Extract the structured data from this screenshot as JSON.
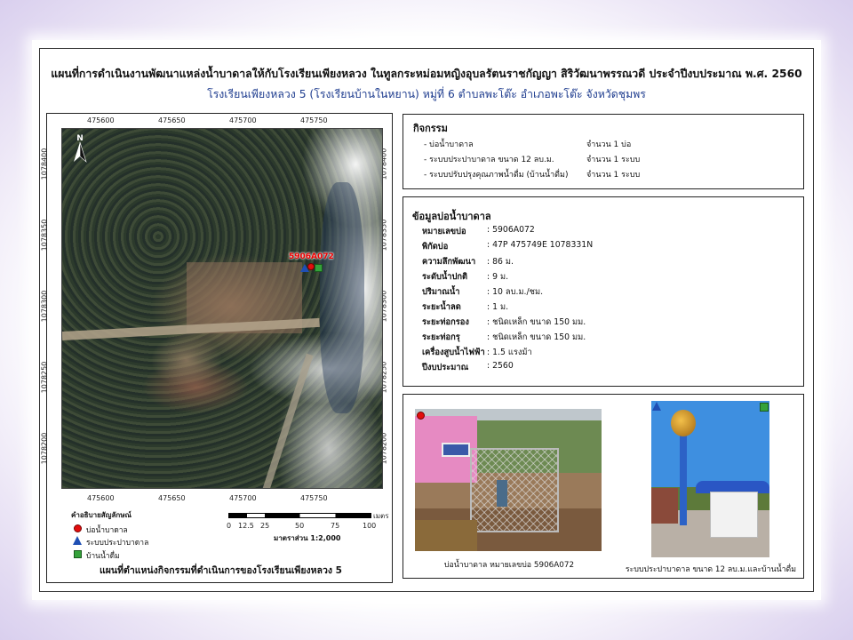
{
  "title": {
    "line1": "แผนที่การดำเนินงานพัฒนาแหล่งน้ำบาดาลให้กับโรงเรียนเพียงหลวง ในทูลกระหม่อมหญิงอุบลรัตนราชกัญญา สิริวัฒนาพรรณวดี ประจำปีงบประมาณ พ.ศ. 2560",
    "line2": "โรงเรียนเพียงหลวง 5 (โรงเรียนบ้านในหยาน) หมู่ที่ 6 ตำบลพะโต๊ะ อำเภอพะโต๊ะ จังหวัดชุมพร"
  },
  "map": {
    "x_ticks": [
      "475600",
      "475650",
      "475700",
      "475750"
    ],
    "y_ticks": [
      "1078400",
      "1078350",
      "1078300",
      "1078250",
      "1078200"
    ],
    "north_label": "N",
    "point_label": "5906A072",
    "legend": {
      "title": "คำอธิบายสัญลักษณ์",
      "items": [
        "บ่อน้ำบาดาล",
        "ระบบประปาบาดาล",
        "บ้านน้ำดื่ม"
      ]
    },
    "scale": {
      "ticks": [
        "0",
        "12.5",
        "25",
        "50",
        "75",
        "100"
      ],
      "unit": "เมตร",
      "ratio": "มาตราส่วน 1:2,000"
    },
    "caption": "แผนที่ตำแหน่งกิจกรรมที่ดำเนินการของโรงเรียนเพียงหลวง 5"
  },
  "activities": {
    "heading": "กิจกรรม",
    "items": [
      {
        "name": "- บ่อน้ำบาดาล",
        "amount": "จำนวน 1 บ่อ"
      },
      {
        "name": "- ระบบประปาบาดาล ขนาด 12 ลบ.ม.",
        "amount": "จำนวน 1 ระบบ"
      },
      {
        "name": "- ระบบปรับปรุงคุณภาพน้ำดื่ม (บ้านน้ำดื่ม)",
        "amount": "จำนวน 1 ระบบ"
      }
    ]
  },
  "well": {
    "heading": "ข้อมูลบ่อน้ำบาดาล",
    "rows": [
      {
        "label": "หมายเลขบ่อ",
        "value": ": 5906A072"
      },
      {
        "label": "พิกัดบ่อ",
        "value": ": 47P 475749E 1078331N"
      },
      {
        "label": "ความลึกพัฒนา",
        "value": ": 86 ม."
      },
      {
        "label": "ระดับน้ำปกติ",
        "value": ": 9 ม."
      },
      {
        "label": "ปริมาณน้ำ",
        "value": ": 10 ลบ.ม./ชม."
      },
      {
        "label": "ระยะน้ำลด",
        "value": ": 1 ม."
      },
      {
        "label": "ระยะท่อกรอง",
        "value": ": ชนิดเหล็ก  ขนาด 150 มม."
      },
      {
        "label": "ระยะท่อกรุ",
        "value": ": ชนิดเหล็ก  ขนาด 150 มม."
      },
      {
        "label": "เครื่องสูบน้ำไฟฟ้า",
        "value": ": 1.5 แรงม้า"
      },
      {
        "label": "ปีงบประมาณ",
        "value": ":  2560"
      }
    ]
  },
  "photos": {
    "caption1": "บ่อน้ำบาดาล หมายเลขบ่อ 5906A072",
    "caption2": "ระบบประปาบาดาล ขนาด 12 ลบ.ม.และบ้านน้ำดื่ม"
  },
  "colors": {
    "well_marker": "#e30d0d",
    "water_system_marker": "#1f4fb4",
    "drinking_house_marker": "#35a23b",
    "subtitle": "#1f3d8f"
  }
}
